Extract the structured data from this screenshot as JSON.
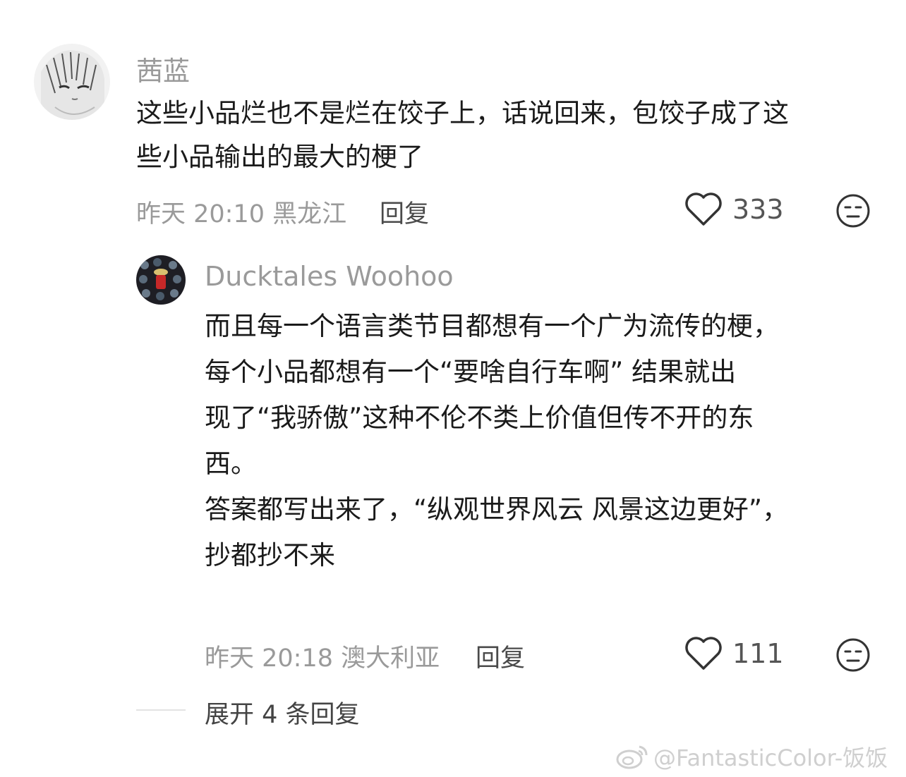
{
  "comments": [
    {
      "username": "茜蓝",
      "content_lines": [
        "这些小品烂也不是烂在饺子上，话说回来，包饺子成了这",
        "些小品输出的最大的梗了"
      ],
      "time": "昨天 20:10",
      "location": "黑龙江",
      "reply_label": "回复",
      "likes": "333",
      "avatar_icon": "anime-avatar"
    },
    {
      "username": "Ducktales Woohoo",
      "content_lines": [
        "而且每一个语言类节目都想有一个广为流传的梗，",
        "每个小品都想有一个“要啥自行车啊”      结果就出",
        "现了“我骄傲”这种不伦不类上价值但传不开的东",
        "西。",
        "答案都写出来了，“纵观世界风云 风景这边更好”，",
        "抄都抄不来"
      ],
      "time": "昨天 20:18",
      "location": "澳大利亚",
      "reply_label": "回复",
      "likes": "111",
      "avatar_icon": "pattern-avatar"
    }
  ],
  "expand_replies": "展开 4 条回复",
  "watermark": "@FantasticColor-饭饭",
  "icons": {
    "like": "heart-outline-icon",
    "dislike": "unamused-face-icon",
    "watermark": "weibo-logo-icon"
  },
  "colors": {
    "text": "#1a1a1a",
    "meta": "#9a9a9a",
    "username": "#9a9a9a",
    "background": "#ffffff"
  }
}
